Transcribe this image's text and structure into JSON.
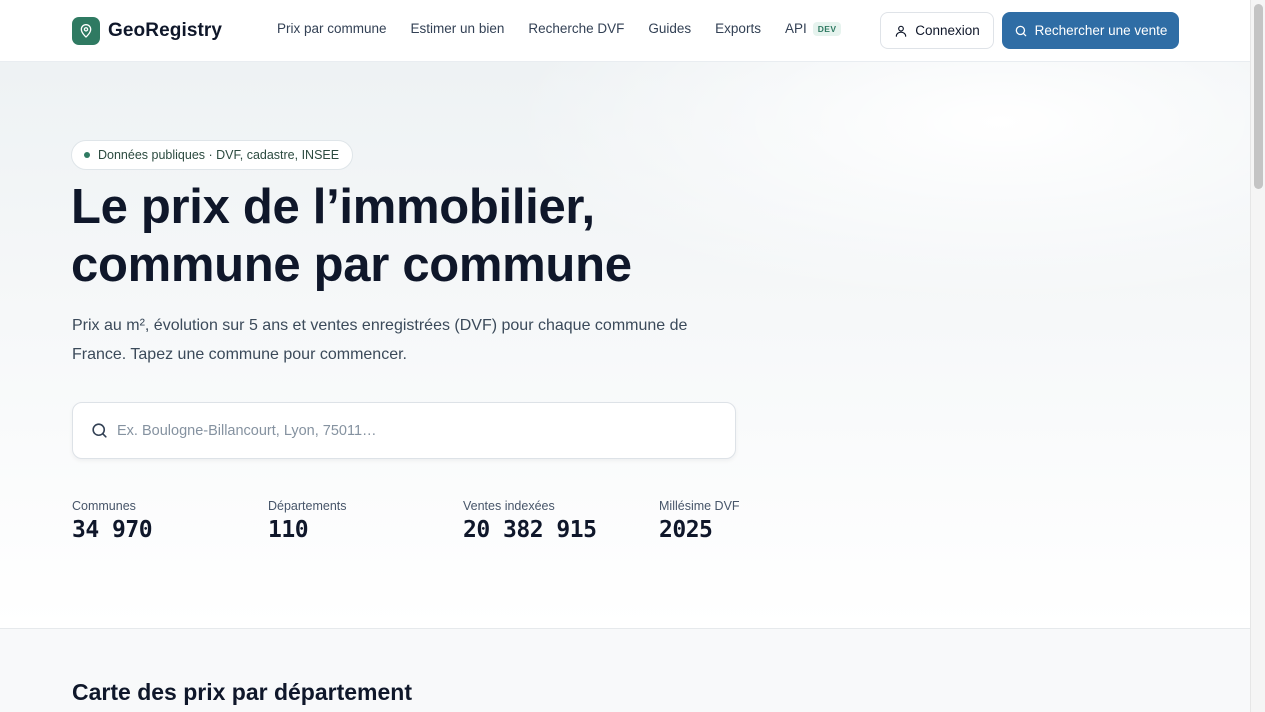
{
  "brand": {
    "name": "GeoRegistry",
    "accent": "#2f7a62",
    "primary": "#2f6da5"
  },
  "nav": {
    "items": [
      {
        "label": "Prix par commune"
      },
      {
        "label": "Estimer un bien"
      },
      {
        "label": "Recherche DVF"
      },
      {
        "label": "Guides"
      },
      {
        "label": "Exports"
      },
      {
        "label": "API"
      }
    ],
    "api_badge": "DEV"
  },
  "header": {
    "login_label": "Connexion",
    "search_label": "Rechercher une vente",
    "login_icon": "user-icon",
    "search_icon": "search-icon"
  },
  "hero": {
    "pill": "Données publiques · DVF, cadastre, INSEE",
    "title_line1": "Le prix de l’immobilier,",
    "title_line2": "commune par commune",
    "subtitle": "Prix au m², évolution sur 5 ans et ventes enregistrées (DVF) pour chaque commune de France. Tapez une commune pour commencer.",
    "search_placeholder": "Ex. Boulogne-Billancourt, Lyon, 75011…",
    "search_value": ""
  },
  "stats": [
    {
      "label": "Communes",
      "value": "34 970"
    },
    {
      "label": "Départements",
      "value": "110"
    },
    {
      "label": "Ventes indexées",
      "value": "20 382 915"
    },
    {
      "label": "Millésime DVF",
      "value": "2025"
    }
  ],
  "section": {
    "title": "Carte des prix par département"
  }
}
